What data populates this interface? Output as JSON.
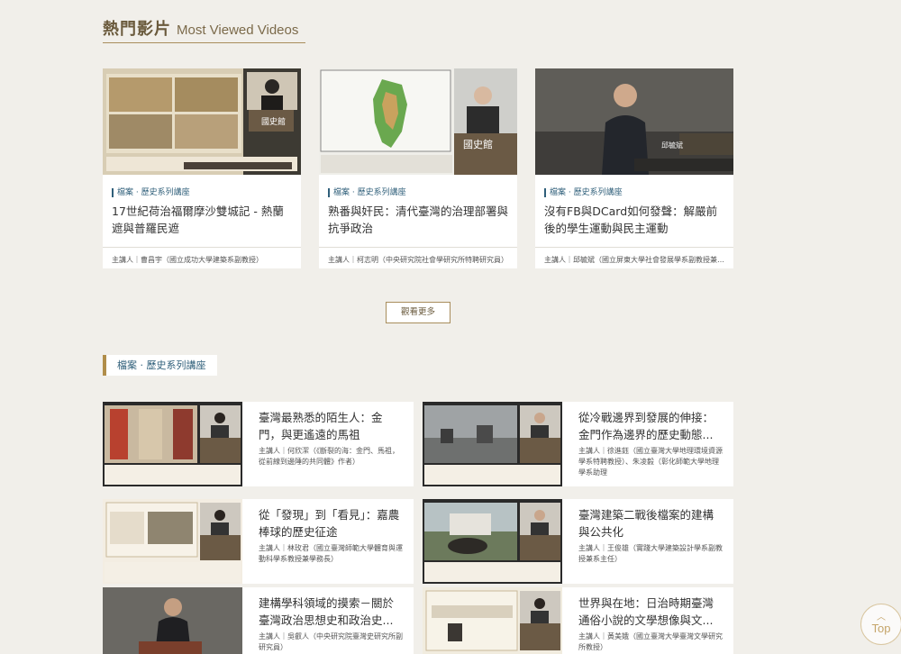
{
  "section1": {
    "title_zh": "熱門影片",
    "title_en": "Most Viewed Videos"
  },
  "cards": [
    {
      "category": "檔案 · 歷史系列講座",
      "title": "17世紀荷治福爾摩沙雙城記 - 熱蘭遮與普羅民遮",
      "host": "主講人｜曹昌宇（國立成功大學建築系副教授）"
    },
    {
      "category": "檔案 · 歷史系列講座",
      "title": "熟番與奸民：清代臺灣的治理部署與抗爭政治",
      "host": "主講人｜柯志明（中央研究院社會學研究所特聘研究員）"
    },
    {
      "category": "檔案 · 歷史系列講座",
      "title": "沒有FB與DCard如何發聲：解嚴前後的學生運動與民主運動",
      "host": "主講人｜邱毓斌（國立屏東大學社會發展學系副教授兼系..."
    }
  ],
  "more_label": "觀看更多",
  "section2": {
    "title": "檔案 · 歷史系列講座"
  },
  "items": [
    {
      "title": "臺灣最熟悉的陌生人：金門，與更遙遠的馬祖",
      "desc": "主講人｜何欣潔（《斷裂的海：金門、馬祖，從前線到邊陲的共同體》作者）"
    },
    {
      "title": "從冷戰邊界到發展的伸接：金門作為邊界的歷史動態...",
      "desc": "主講人｜徐進鈺（國立臺灣大學地理環境資源學系特聘教授）、朱凌毅（彰化師範大學地理學系助理"
    },
    {
      "title": "從「發現」到「看見」：嘉農棒球的歷史征途",
      "desc": "主講人｜林玫君（國立臺灣師範大學體育與運動科學系教授兼學務長）"
    },
    {
      "title": "臺灣建築二戰後檔案的建構與公共化",
      "desc": "主講人｜王俊雄（實踐大學建築設計學系副教授兼系主任）"
    },
    {
      "title": "建構學科領域的摸索－關於臺灣政治思想史和政治史...",
      "desc": "主講人｜吳叡人（中央研究院臺灣史研究所副研究員）"
    },
    {
      "title": "世界與在地：日治時期臺灣通俗小說的文學想像與文...",
      "desc": "主講人｜黃美娥（國立臺灣大學臺灣文學研究所教授）"
    }
  ],
  "top_label": "Top",
  "colors": {
    "accent_gold": "#a88d5c",
    "category_blue": "#2f5f7a",
    "background": "#f1efea"
  }
}
